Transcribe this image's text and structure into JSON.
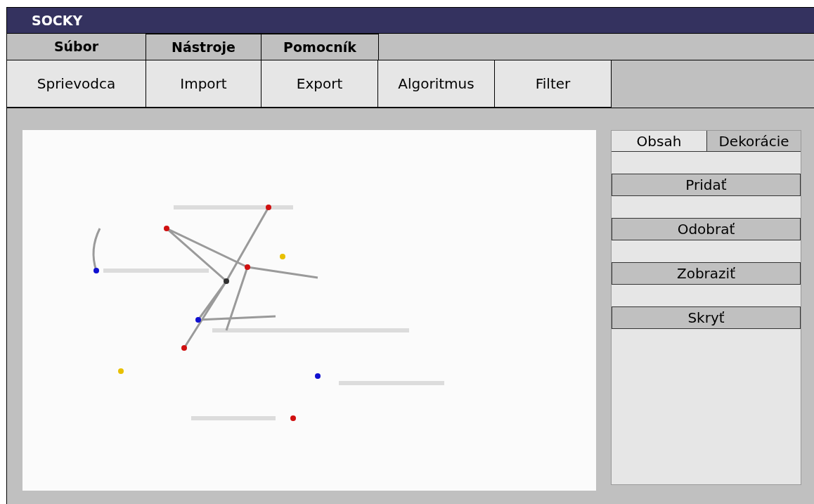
{
  "window": {
    "title": "SOCKY"
  },
  "menu": [
    {
      "label": "Súbor"
    },
    {
      "label": "Nástroje"
    },
    {
      "label": "Pomocník"
    }
  ],
  "toolbar": [
    {
      "label": "Sprievodca"
    },
    {
      "label": "Import"
    },
    {
      "label": "Export"
    },
    {
      "label": "Algoritmus"
    },
    {
      "label": "Filter"
    }
  ],
  "side_panel": {
    "tabs": [
      {
        "label": "Obsah",
        "selected": true
      },
      {
        "label": "Dekorácie",
        "selected": false
      }
    ],
    "buttons": [
      {
        "label": "Pridať"
      },
      {
        "label": "Odobrať"
      },
      {
        "label": "Zobraziť"
      },
      {
        "label": "Skryť"
      }
    ]
  }
}
